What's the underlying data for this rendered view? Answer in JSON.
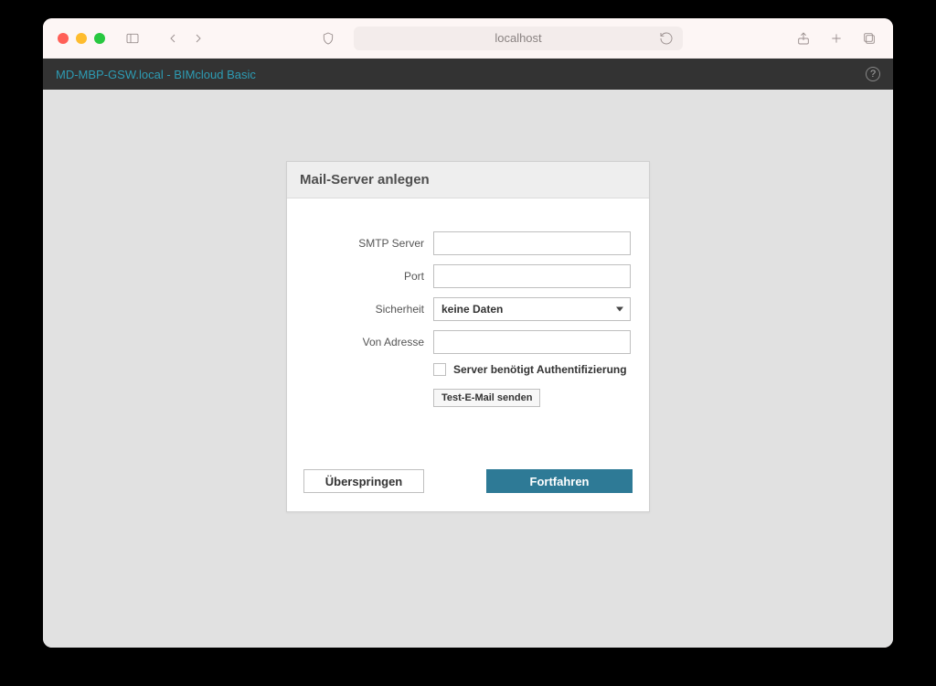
{
  "browser": {
    "url": "localhost"
  },
  "app": {
    "title": "MD-MBP-GSW.local - BIMcloud Basic",
    "help": "?"
  },
  "panel": {
    "title": "Mail-Server anlegen",
    "labels": {
      "smtp": "SMTP Server",
      "port": "Port",
      "security": "Sicherheit",
      "from": "Von Adresse"
    },
    "security_value": "keine Daten",
    "auth_label": "Server benötigt Authentifizierung",
    "test_button": "Test-E-Mail senden",
    "skip": "Überspringen",
    "continue": "Fortfahren"
  }
}
